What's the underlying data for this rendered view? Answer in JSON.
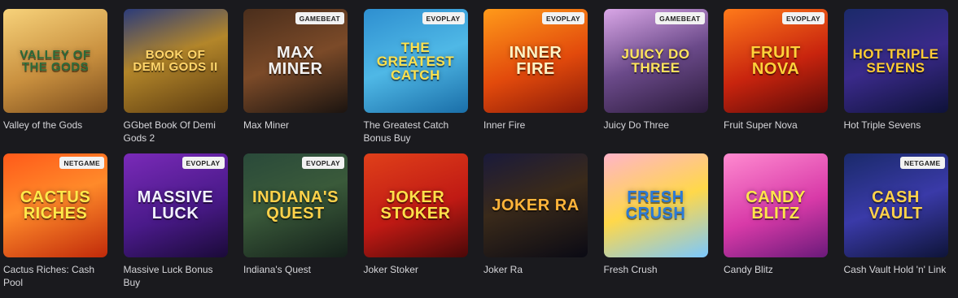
{
  "games": [
    {
      "title": "Valley of the Gods",
      "art": "VALLEY OF THE GODS",
      "badge": "",
      "bg": "linear-gradient(160deg,#f7d27a 0%,#c9903f 55%,#7a4c1c 100%)",
      "color": "#2b6a3a"
    },
    {
      "title": "GGbet Book Of Demi Gods 2",
      "art": "BOOK OF DEMI GODS II",
      "badge": "",
      "bg": "linear-gradient(160deg,#2b3b7a 0%,#b3862a 45%,#5a3a10 100%)",
      "color": "#ffd56b"
    },
    {
      "title": "Max Miner",
      "art": "MAX MINER",
      "badge": "GAMEBEAT",
      "bg": "linear-gradient(160deg,#4a2e1c 0%,#7b4a28 50%,#1b1410 100%)",
      "color": "#f2f2f2"
    },
    {
      "title": "The Greatest Catch Bonus Buy",
      "art": "THE GREATEST CATCH",
      "badge": "EVOPLAY",
      "bg": "linear-gradient(160deg,#2e8fd0 0%,#4fb8e6 50%,#1a6ea8 100%)",
      "color": "#ffe14d"
    },
    {
      "title": "Inner Fire",
      "art": "INNER FIRE",
      "badge": "EVOPLAY",
      "bg": "linear-gradient(160deg,#ff9a1a 0%,#e24a0c 55%,#8a1a08 100%)",
      "color": "#fff3c4"
    },
    {
      "title": "Juicy Do Three",
      "art": "JUICY DO THREE",
      "badge": "GAMEBEAT",
      "bg": "linear-gradient(160deg,#d9a6e6 0%,#6b4a8a 50%,#2a1a3a 100%)",
      "color": "#ffe45c"
    },
    {
      "title": "Fruit Super Nova",
      "art": "FRUIT NOVA",
      "badge": "EVOPLAY",
      "bg": "linear-gradient(160deg,#ff7a1a 0%,#c8240e 55%,#5a0a08 100%)",
      "color": "#ffd23a"
    },
    {
      "title": "Hot Triple Sevens",
      "art": "HOT TRIPLE SEVENS",
      "badge": "",
      "bg": "linear-gradient(160deg,#1b2a6a 0%,#3a2a8a 50%,#0e1238 100%)",
      "color": "#ffcc33"
    },
    {
      "title": "Cactus Riches: Cash Pool",
      "art": "CACTUS RICHES",
      "badge": "NETGAME",
      "bg": "linear-gradient(160deg,#ff5a1a 0%,#ff8a2a 45%,#c02a0a 100%)",
      "color": "#ffe94a"
    },
    {
      "title": "Massive Luck Bonus Buy",
      "art": "MASSIVE LUCK",
      "badge": "EVOPLAY",
      "bg": "linear-gradient(160deg,#7a2ab8 0%,#4a1a8a 55%,#1a0a38 100%)",
      "color": "#f2f2ff"
    },
    {
      "title": "Indiana's Quest",
      "art": "INDIANA'S QUEST",
      "badge": "EVOPLAY",
      "bg": "linear-gradient(160deg,#2a4a3a 0%,#3a5a3a 45%,#14201a 100%)",
      "color": "#ffd24a"
    },
    {
      "title": "Joker Stoker",
      "art": "JOKER STOKER",
      "badge": "",
      "bg": "linear-gradient(160deg,#e0401a 0%,#c01a14 55%,#4a0808 100%)",
      "color": "#ffe04a"
    },
    {
      "title": "Joker Ra",
      "art": "JOKER RA",
      "badge": "",
      "bg": "linear-gradient(160deg,#1a1a3a 0%,#3a2a1a 45%,#0a0a14 100%)",
      "color": "#ffb43a"
    },
    {
      "title": "Fresh Crush",
      "art": "FRESH CRUSH",
      "badge": "",
      "bg": "linear-gradient(160deg,#ffb4c8 0%,#ffd84a 50%,#7ac8ff 100%)",
      "color": "#2a7ad8"
    },
    {
      "title": "Candy Blitz",
      "art": "CANDY BLITZ",
      "badge": "",
      "bg": "linear-gradient(160deg,#ff8ad0 0%,#d83aa8 55%,#6a1a7a 100%)",
      "color": "#ffe64a"
    },
    {
      "title": "Cash Vault Hold 'n' Link",
      "art": "CASH VAULT",
      "badge": "NETGAME",
      "bg": "linear-gradient(160deg,#1a2a6a 0%,#3a3aa8 50%,#0e1438 100%)",
      "color": "#ffd24a"
    }
  ]
}
